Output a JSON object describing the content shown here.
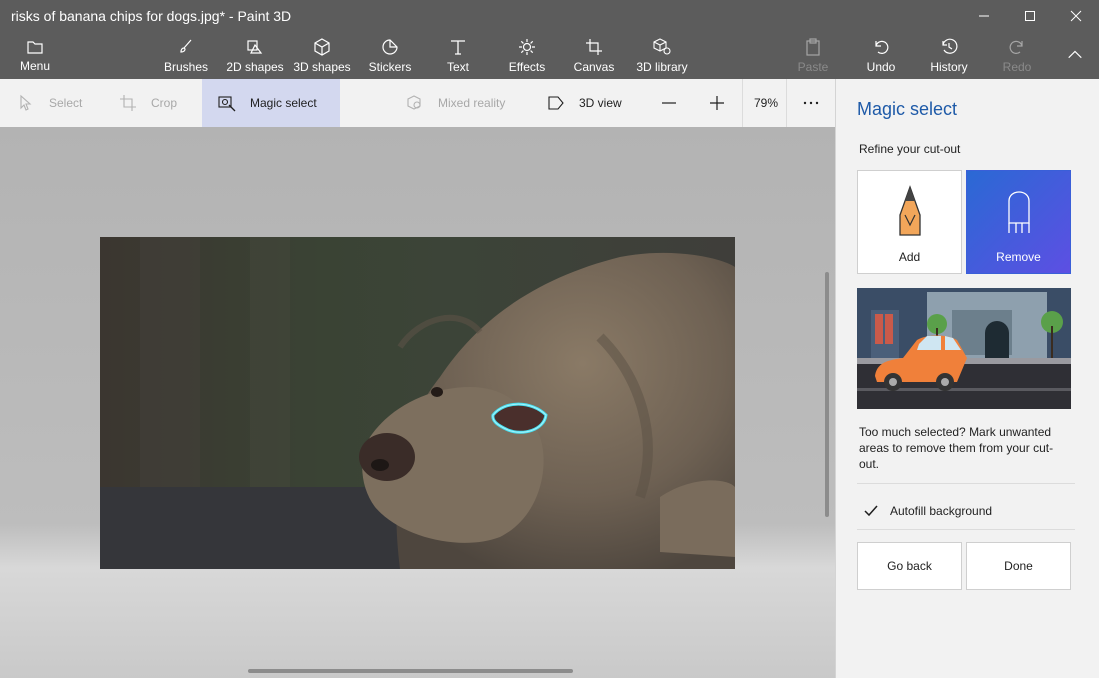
{
  "window": {
    "title": "risks of banana chips for dogs.jpg* - Paint 3D"
  },
  "toolbar": {
    "menu": "Menu",
    "brushes": "Brushes",
    "shapes2d": "2D shapes",
    "shapes3d": "3D shapes",
    "stickers": "Stickers",
    "text": "Text",
    "effects": "Effects",
    "canvas": "Canvas",
    "library3d": "3D library",
    "paste": "Paste",
    "undo": "Undo",
    "history": "History",
    "redo": "Redo"
  },
  "subtoolbar": {
    "select": "Select",
    "crop": "Crop",
    "magic_select": "Magic select",
    "mixed_reality": "Mixed reality",
    "view3d": "3D view",
    "zoom": "79%"
  },
  "panel": {
    "title": "Magic select",
    "subtitle": "Refine your cut-out",
    "add_label": "Add",
    "remove_label": "Remove",
    "help_text": "Too much selected? Mark unwanted areas to remove them from your cut-out.",
    "autofill_label": "Autofill background",
    "autofill_checked": true,
    "go_back": "Go back",
    "done": "Done"
  },
  "colors": {
    "chrome": "#5c5c5c",
    "accent_blue": "#1e5aa8",
    "active_tool": "#d3d8ef",
    "selection_outline": "#48e0f0"
  }
}
